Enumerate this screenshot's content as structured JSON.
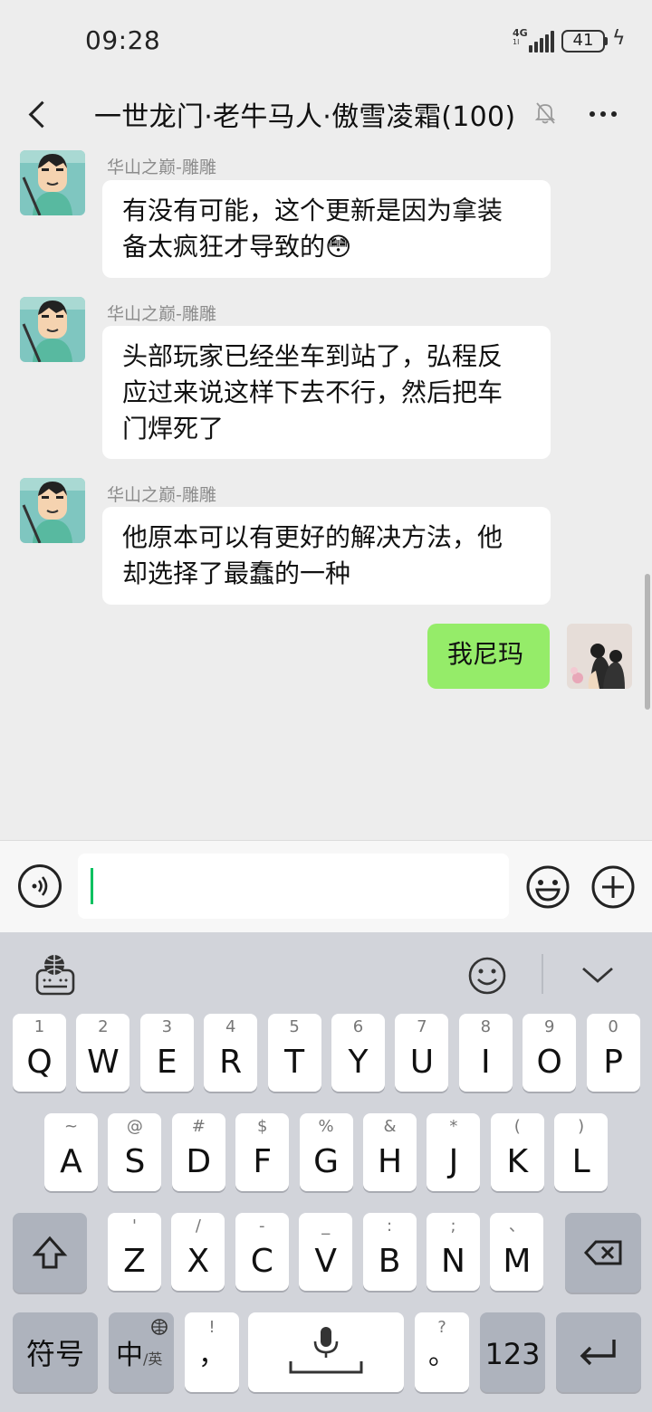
{
  "status_bar": {
    "time": "09:28",
    "network": "4G",
    "network_sub": "1l",
    "battery": "41"
  },
  "header": {
    "title": "一世龙门·老牛马人·傲雪凌霜(100)"
  },
  "messages": [
    {
      "sender": "华山之巅-雕雕",
      "lines": [
        "有没有可能，这个更新是因为拿装",
        "备太疯狂才导致的😳"
      ]
    },
    {
      "sender": "华山之巅-雕雕",
      "lines": [
        "头部玩家已经坐车到站了，弘程反",
        "应过来说这样下去不行，然后把车",
        "门焊死了"
      ]
    },
    {
      "sender": "华山之巅-雕雕",
      "lines": [
        "他原本可以有更好的解决方法，他",
        "却选择了最蠢的一种"
      ]
    },
    {
      "self": true,
      "lines": [
        "我尼玛"
      ]
    }
  ],
  "keyboard": {
    "row1": [
      {
        "main": "Q",
        "sub": "1"
      },
      {
        "main": "W",
        "sub": "2"
      },
      {
        "main": "E",
        "sub": "3"
      },
      {
        "main": "R",
        "sub": "4"
      },
      {
        "main": "T",
        "sub": "5"
      },
      {
        "main": "Y",
        "sub": "6"
      },
      {
        "main": "U",
        "sub": "7"
      },
      {
        "main": "I",
        "sub": "8"
      },
      {
        "main": "O",
        "sub": "9"
      },
      {
        "main": "P",
        "sub": "0"
      }
    ],
    "row2": [
      {
        "main": "A",
        "sub": "~"
      },
      {
        "main": "S",
        "sub": "@"
      },
      {
        "main": "D",
        "sub": "#"
      },
      {
        "main": "F",
        "sub": "$"
      },
      {
        "main": "G",
        "sub": "%"
      },
      {
        "main": "H",
        "sub": "&"
      },
      {
        "main": "J",
        "sub": "*"
      },
      {
        "main": "K",
        "sub": "("
      },
      {
        "main": "L",
        "sub": ")"
      }
    ],
    "row3": [
      {
        "main": "Z",
        "sub": "'"
      },
      {
        "main": "X",
        "sub": "/"
      },
      {
        "main": "C",
        "sub": "-"
      },
      {
        "main": "V",
        "sub": "_"
      },
      {
        "main": "B",
        "sub": ":"
      },
      {
        "main": "N",
        "sub": ";"
      },
      {
        "main": "M",
        "sub": "、"
      }
    ],
    "symbols": "符号",
    "zh": "中",
    "en": "/英",
    "comma": "，",
    "comma_sub": "!",
    "period": "。",
    "period_sub": "?",
    "num": "123"
  }
}
